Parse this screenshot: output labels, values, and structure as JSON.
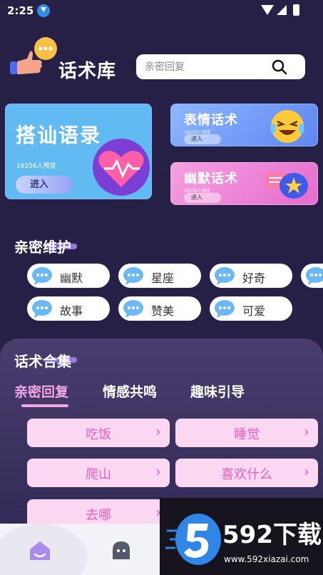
{
  "status_bar": {
    "time": "2:25"
  },
  "header": {
    "title": "话术库",
    "search": {
      "placeholder": "亲密回复",
      "value": ""
    }
  },
  "cards": {
    "big": {
      "title": "搭讪语录",
      "count": "16256人预览",
      "enter": "进入"
    },
    "emoji": {
      "title": "表情话术",
      "count": "16256人预览",
      "enter": "进入"
    },
    "humor": {
      "title": "幽默话术",
      "count": "16256人预览",
      "enter": "进入"
    }
  },
  "intimacy": {
    "title": "亲密维护",
    "chips": [
      "幽默",
      "星座",
      "好奇",
      "故事",
      "赞美",
      "可爱"
    ]
  },
  "collection": {
    "title": "话术合集",
    "tabs": [
      "亲密回复",
      "情感共鸣",
      "趣味引导"
    ],
    "active_tab": 0,
    "topics": [
      "吃饭",
      "睡觉",
      "爬山",
      "喜欢什么",
      "去哪"
    ]
  },
  "watermark": {
    "brand": "592下载",
    "url": "www.592xiazai.com"
  },
  "colors": {
    "background": "#262046",
    "accent_pink": "#ee5db8",
    "topic_bg": "#fbd8f2",
    "card_blue": "#62baf2",
    "card_pink": "#e46ccd"
  }
}
